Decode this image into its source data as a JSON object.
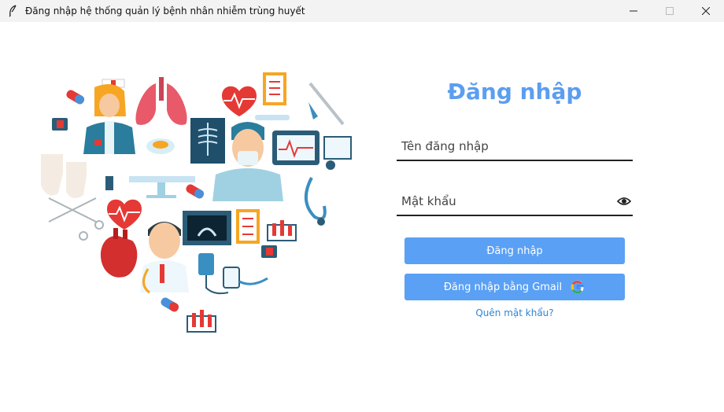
{
  "window": {
    "title": "Đăng nhập hệ thống quản lý bệnh nhân nhiễm trùng huyết",
    "app_icon": "feather-icon",
    "controls": [
      "minimize-icon",
      "maximize-icon",
      "close-icon"
    ]
  },
  "illustration": {
    "icon": "medical-heart-illustration"
  },
  "login": {
    "heading": "Đăng nhập",
    "username_placeholder": "Tên đăng nhập",
    "username_value": "",
    "password_placeholder": "Mật khẩu",
    "password_value": "",
    "show_password_icon": "eye-icon",
    "login_button": "Đăng nhập",
    "gmail_button": "Đăng nhập bằng Gmail",
    "gmail_icon": "google-icon",
    "forgot_link": "Quên mật khẩu?"
  },
  "colors": {
    "accent": "#5aa0f5",
    "heading": "#5b9ef0",
    "link": "#2e86d6",
    "titlebar": "#f3f3f3"
  }
}
